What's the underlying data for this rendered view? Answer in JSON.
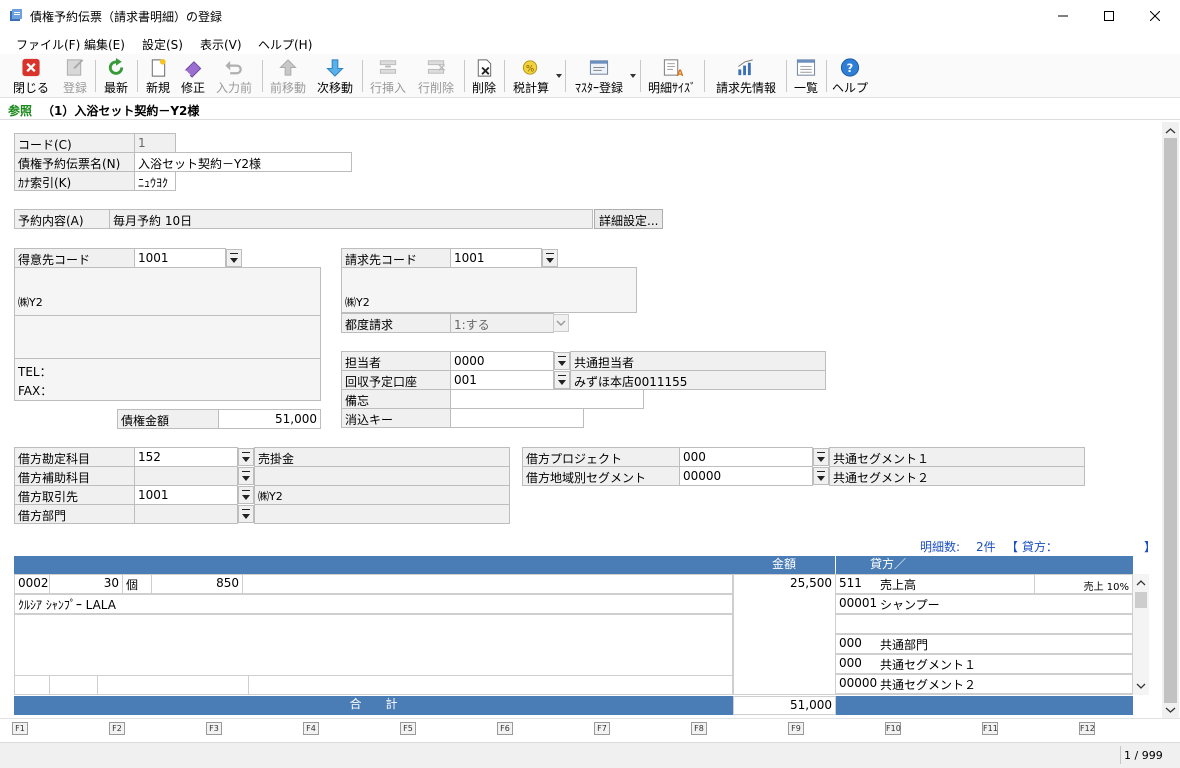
{
  "window": {
    "title": "債権予約伝票（請求書明細）の登録"
  },
  "menu": [
    "ファイル(F)",
    "編集(E)",
    "設定(S)",
    "表示(V)",
    "ヘルプ(H)"
  ],
  "toolbar": {
    "close": "閉じる",
    "register": "登録",
    "refresh": "最新",
    "new": "新規",
    "edit": "修正",
    "prev_input": "入力前",
    "prev_move": "前移動",
    "next_move": "次移動",
    "row_insert": "行挿入",
    "row_delete": "行削除",
    "delete": "削除",
    "tax_calc": "税計算",
    "master_register": "ﾏｽﾀｰ登録",
    "detail_size": "明細ｻｲｽﾞ",
    "billing_info": "請求先情報",
    "list": "一覧",
    "help": "ヘルプ"
  },
  "mode": {
    "label": "参照",
    "record": "（1）入浴セット契約－Y2様"
  },
  "form": {
    "code_label": "コード(C)",
    "code_value": "1",
    "name_label": "債権予約伝票名(N)",
    "name_value": "入浴セット契約－Y2様",
    "kana_label": "ｶﾅ索引(K)",
    "kana_value": "ﾆｭｳﾖｸ",
    "contract_label": "予約内容(A)",
    "contract_value": "毎月予約 10日",
    "detail_button": "詳細設定...",
    "customer_label": "得意先コード",
    "customer_code": "1001",
    "customer_name": "㈱Y2",
    "tel_label": "TEL：",
    "fax_label": "FAX：",
    "amount_label": "債権金額",
    "amount_value": "51,000",
    "billing_label": "請求先コード",
    "billing_code": "1001",
    "billing_name": "㈱Y2",
    "each_billing_label": "都度請求",
    "each_billing_value": "1:する",
    "staff_label": "担当者",
    "staff_code": "0000",
    "staff_name": "共通担当者",
    "account_label": "回収予定口座",
    "account_code": "001",
    "account_name": "みずほ本店0011155",
    "memo_label": "備忘",
    "memo_value": "",
    "match_key_label": "消込キー",
    "match_key_value": "",
    "debit_account_label": "借方勘定科目",
    "debit_account_code": "152",
    "debit_account_name": "売掛金",
    "debit_sub_label": "借方補助科目",
    "debit_sub_code": "",
    "debit_sub_name": "",
    "debit_partner_label": "借方取引先",
    "debit_partner_code": "1001",
    "debit_partner_name": "㈱Y2",
    "debit_dept_label": "借方部門",
    "debit_dept_code": "",
    "debit_dept_name": "",
    "debit_project_label": "借方プロジェクト",
    "debit_project_code": "000",
    "debit_project_name": "共通セグメント１",
    "debit_region_label": "借方地域別セグメント",
    "debit_region_code": "00000",
    "debit_region_name": "共通セグメント２"
  },
  "detail": {
    "count_label": "明細数:",
    "count_value": "2件",
    "credit_label": "【 貸方：",
    "credit_close": "】",
    "header_amount": "金額",
    "header_credit": "貸方／",
    "row1": {
      "code": "0002",
      "qty": "30",
      "unit": "個",
      "price": "850",
      "amount": "25,500",
      "product": "ｸﾙｼｱ ｼｬﾝﾌﾟｰ LALA"
    },
    "credit_rows": [
      {
        "code": "511",
        "name": "売上高",
        "tax": "売上 10%"
      },
      {
        "code": "00001",
        "name": "シャンプー",
        "tax": ""
      },
      {
        "code": "",
        "name": "",
        "tax": ""
      },
      {
        "code": "000",
        "name": "共通部門",
        "tax": ""
      },
      {
        "code": "000",
        "name": "共通セグメント１",
        "tax": ""
      },
      {
        "code": "00000",
        "name": "共通セグメント２",
        "tax": ""
      }
    ],
    "total_label": "合　　計",
    "total_value": "51,000"
  },
  "fkeys": [
    "F1",
    "F2",
    "F3",
    "F4",
    "F5",
    "F6",
    "F7",
    "F8",
    "F9",
    "F10",
    "F11",
    "F12"
  ],
  "status": {
    "page": "1 / 999"
  }
}
